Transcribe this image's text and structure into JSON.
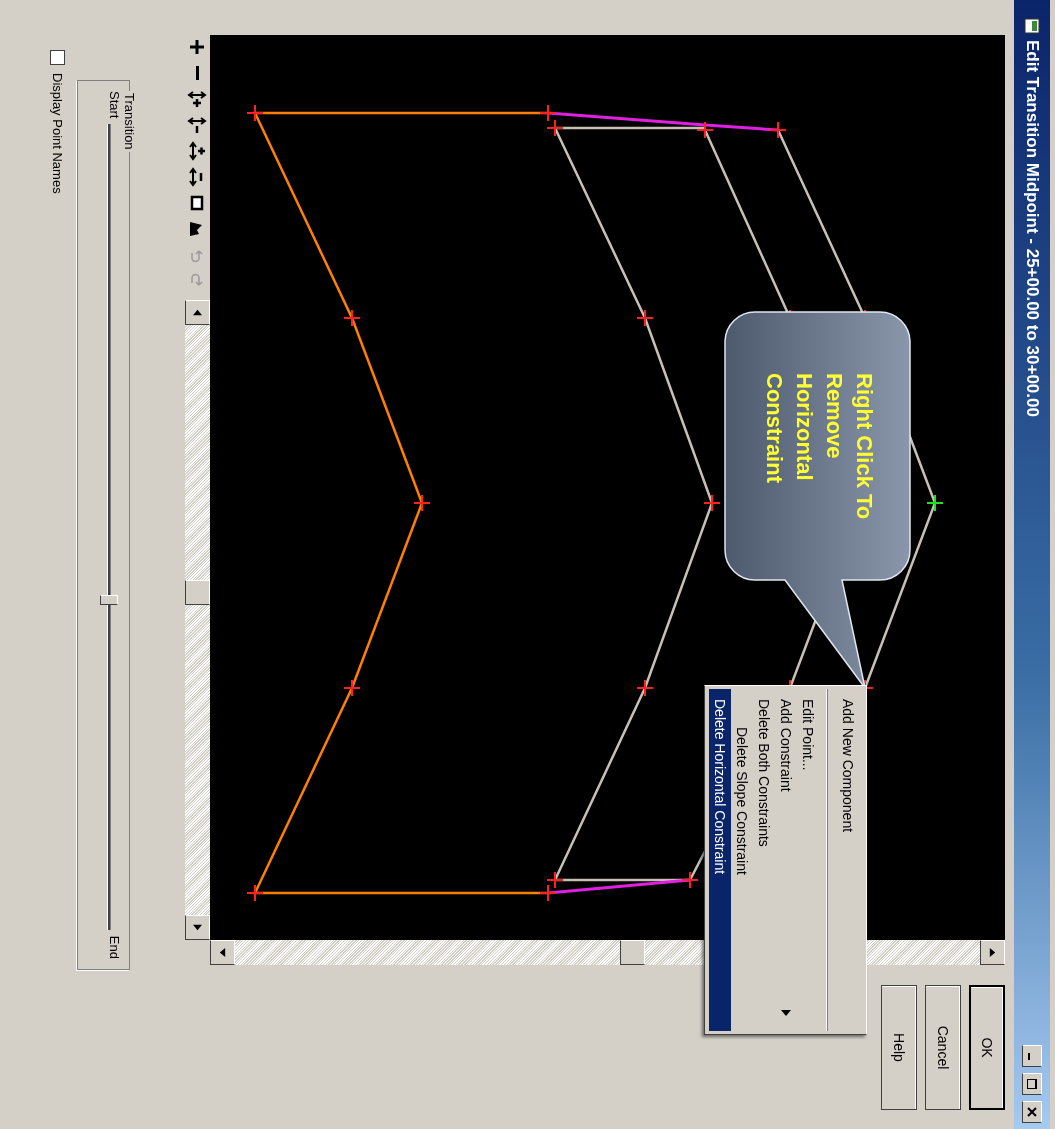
{
  "window": {
    "title": "Edit Transition Midpoint - 25+00.00 to 30+00.00"
  },
  "toolbar": [
    {
      "kind": "plus",
      "disabled": false
    },
    {
      "kind": "minus",
      "disabled": false
    },
    {
      "kind": "vplus",
      "disabled": false
    },
    {
      "kind": "vminus",
      "disabled": false
    },
    {
      "kind": "hplus",
      "disabled": false
    },
    {
      "kind": "hminus",
      "disabled": false
    },
    {
      "kind": "rect",
      "disabled": false
    },
    {
      "kind": "shape",
      "disabled": false
    },
    {
      "kind": "undo",
      "disabled": true
    },
    {
      "kind": "redo",
      "disabled": true
    }
  ],
  "buttons": [
    {
      "label": "OK",
      "default": true
    },
    {
      "label": "Cancel",
      "default": false
    },
    {
      "label": "Help",
      "default": false
    }
  ],
  "callout": {
    "text": "Right Click To Remove Horizontal Constraint"
  },
  "context_menu": {
    "items": [
      {
        "label": "Add New Component",
        "indented": false,
        "selected": false,
        "submenu": false,
        "separator_after": true
      },
      {
        "label": "Edit Point...",
        "indented": false,
        "selected": false,
        "submenu": false,
        "separator_after": false
      },
      {
        "label": "Add Constraint",
        "indented": false,
        "selected": false,
        "submenu": true,
        "separator_after": false
      },
      {
        "label": "Delete Both Constraints",
        "indented": false,
        "selected": false,
        "submenu": false,
        "separator_after": false
      },
      {
        "label": "Delete Slope Constraint",
        "indented": true,
        "selected": false,
        "submenu": false,
        "separator_after": false
      },
      {
        "label": "Delete Horizontal Constraint",
        "indented": false,
        "selected": true,
        "submenu": false,
        "separator_after": false
      }
    ]
  },
  "transition": {
    "legend": "Transition",
    "start_label": "Start",
    "end_label": "End",
    "level": 0.59
  },
  "display_point_names": {
    "label": "Display Point Names",
    "checked": false
  }
}
